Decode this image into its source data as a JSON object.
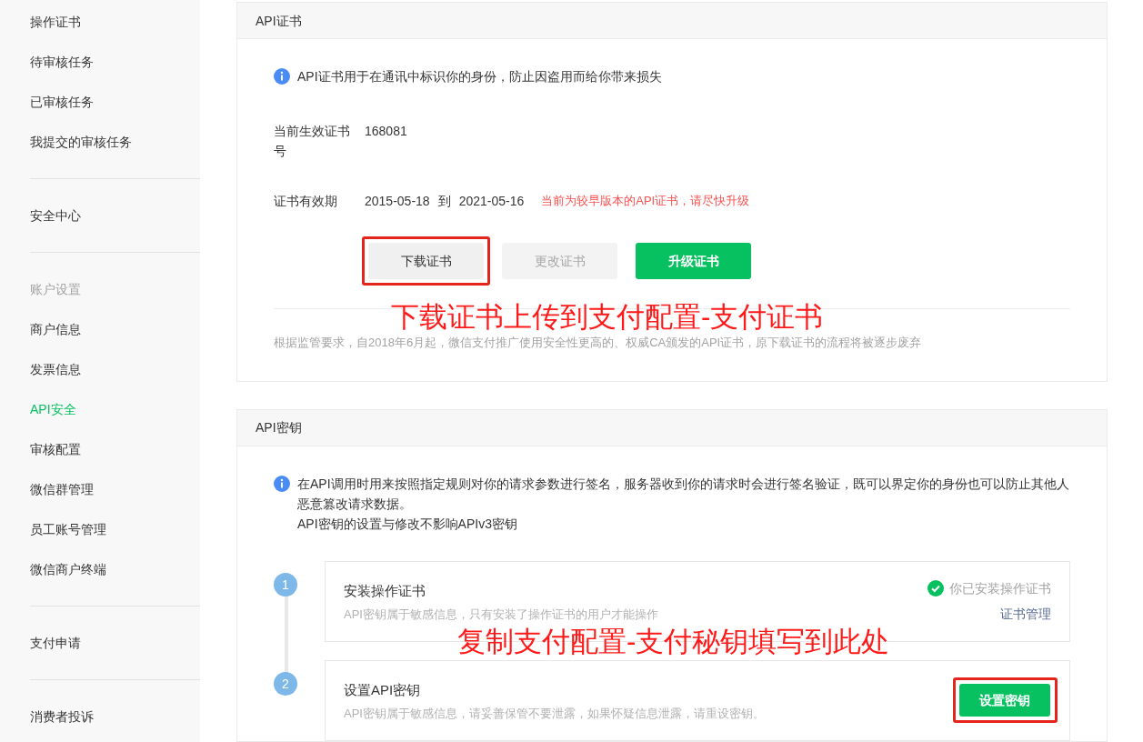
{
  "sidebar": {
    "groups": [
      {
        "items": [
          {
            "label": "操作证书",
            "kind": "link",
            "selected": false
          },
          {
            "label": "待审核任务",
            "kind": "link",
            "selected": false
          },
          {
            "label": "已审核任务",
            "kind": "link",
            "selected": false
          },
          {
            "label": "我提交的审核任务",
            "kind": "link",
            "selected": false
          }
        ]
      },
      {
        "items": [
          {
            "label": "安全中心",
            "kind": "link",
            "selected": false
          }
        ]
      },
      {
        "items": [
          {
            "label": "账户设置",
            "kind": "heading",
            "selected": false
          },
          {
            "label": "商户信息",
            "kind": "link",
            "selected": false
          },
          {
            "label": "发票信息",
            "kind": "link",
            "selected": false
          },
          {
            "label": "API安全",
            "kind": "link",
            "selected": true
          },
          {
            "label": "审核配置",
            "kind": "link",
            "selected": false
          },
          {
            "label": "微信群管理",
            "kind": "link",
            "selected": false
          },
          {
            "label": "员工账号管理",
            "kind": "link",
            "selected": false
          },
          {
            "label": "微信商户终端",
            "kind": "link",
            "selected": false
          }
        ]
      },
      {
        "items": [
          {
            "label": "支付申请",
            "kind": "link",
            "selected": false
          }
        ]
      },
      {
        "items": [
          {
            "label": "消费者投诉",
            "kind": "link",
            "selected": false
          }
        ]
      }
    ]
  },
  "certificate_card": {
    "title": "API证书",
    "info": "API证书用于在通讯中标识你的身份，防止因盗用而给你带来损失",
    "fields": [
      {
        "label": "当前生效证书号",
        "value": "168081"
      },
      {
        "label": "证书有效期",
        "start": "2015-05-18",
        "separator": "到",
        "end": "2021-05-16",
        "warning": "当前为较早版本的API证书，请尽快升级"
      }
    ],
    "buttons": [
      {
        "label": "下载证书",
        "kind": "default",
        "highlighted": true
      },
      {
        "label": "更改证书",
        "kind": "disabled",
        "highlighted": false
      },
      {
        "label": "升级证书",
        "kind": "primary",
        "highlighted": false
      }
    ],
    "footnote": "根据监管要求，自2018年6月起，微信支付推广使用安全性更高的、权威CA颁发的API证书，原下载证书的流程将被逐步废弃"
  },
  "key_card": {
    "title": "API密钥",
    "info": [
      "在API调用时用来按照指定规则对你的请求参数进行签名，服务器收到你的请求时会进行签名验证，既可以界定你的身份也可以防止其他人恶意篡改请求数据。",
      "API密钥的设置与修改不影响APIv3密钥"
    ],
    "steps": [
      {
        "number": "1",
        "title": "安装操作证书",
        "description": "API密钥属于敏感信息，只有安装了操作证书的用户才能操作",
        "status": "你已安装操作证书",
        "link": "证书管理"
      },
      {
        "number": "2",
        "title": "设置API密钥",
        "description": "API密钥属于敏感信息，请妥善保管不要泄露，如果怀疑信息泄露，请重设密钥。",
        "button": {
          "label": "设置密钥",
          "kind": "primary",
          "highlighted": true
        }
      }
    ]
  },
  "annotations": [
    "下载证书上传到支付配置-支付证书",
    "复制支付配置-支付秘钥填写到此处"
  ]
}
